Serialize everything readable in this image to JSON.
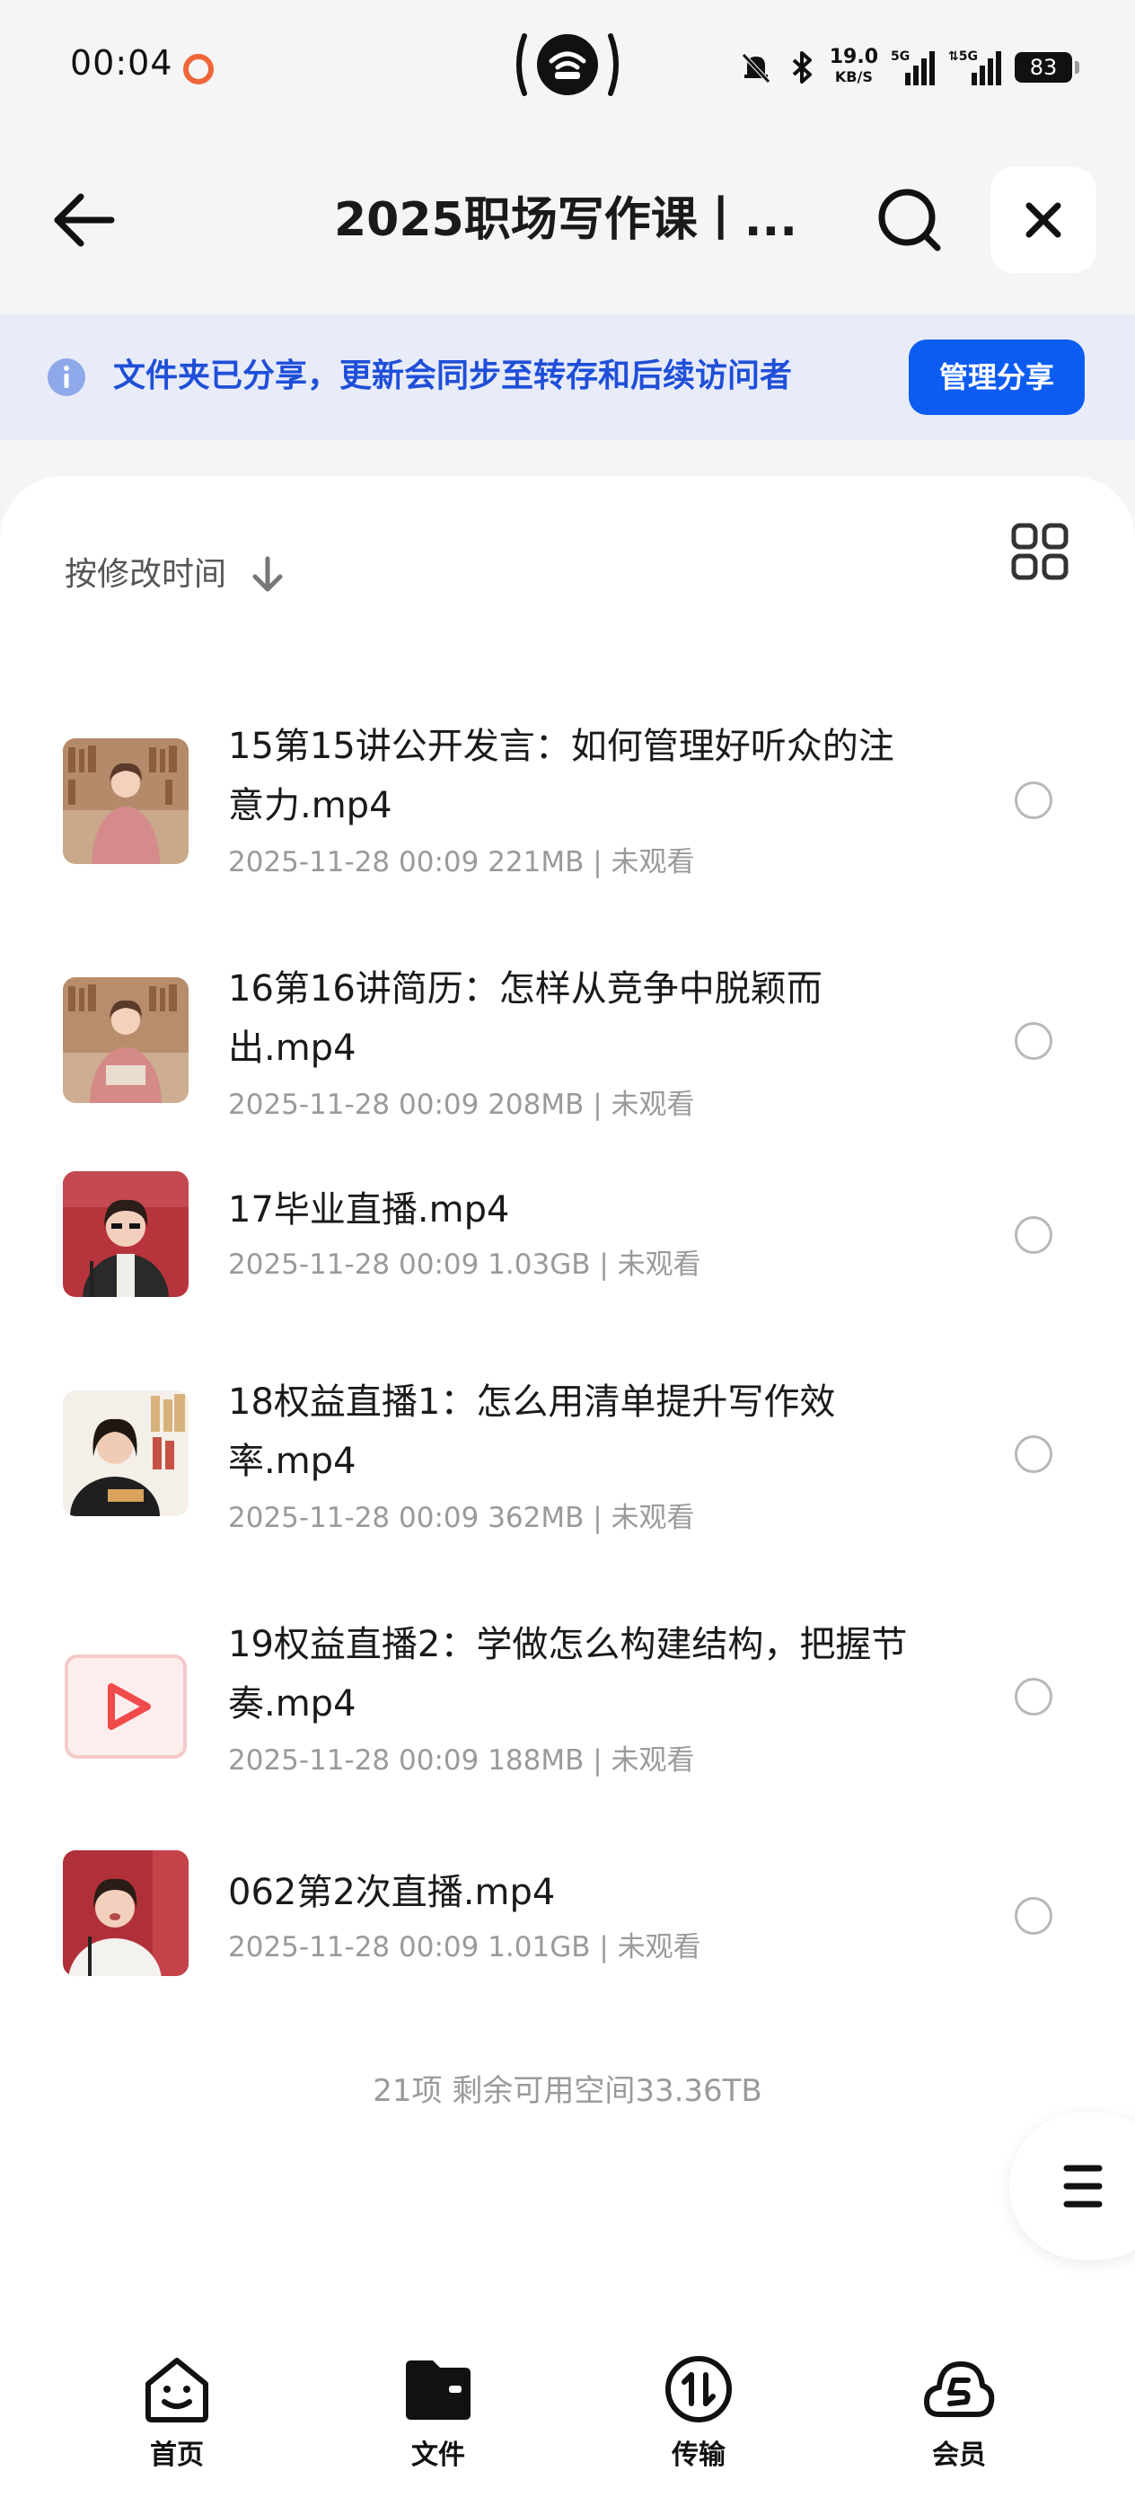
{
  "status_bar": {
    "time": "00:04",
    "net_speed_value": "19.0",
    "net_speed_unit": "KB/S",
    "battery": "83"
  },
  "header": {
    "title": "2025职场写作课丨..."
  },
  "banner": {
    "text": "文件夹已分享，更新会同步至转存和后续访问者",
    "manage_label": "管理分享"
  },
  "sort": {
    "label": "按修改时间"
  },
  "files": [
    {
      "name": "15第15讲公开发言：如何管理好听众的注意力.mp4",
      "meta": "2025-11-28 00:09  221MB | 未观看"
    },
    {
      "name": "16第16讲简历：怎样从竞争中脱颖而出.mp4",
      "meta": "2025-11-28 00:09  208MB | 未观看"
    },
    {
      "name": "17毕业直播.mp4",
      "meta": "2025-11-28 00:09  1.03GB | 未观看"
    },
    {
      "name": "18权益直播1：怎么用清单提升写作效率.mp4",
      "meta": "2025-11-28 00:09  362MB | 未观看"
    },
    {
      "name": "19权益直播2：学做怎么构建结构，把握节奏.mp4",
      "meta": "2025-11-28 00:09  188MB | 未观看"
    },
    {
      "name": "062第2次直播.mp4",
      "meta": "2025-11-28 00:09  1.01GB | 未观看"
    }
  ],
  "footer": {
    "summary": "21项 剩余可用空间33.36TB"
  },
  "nav": {
    "home": "首页",
    "files": "文件",
    "transfer": "传输",
    "member": "会员"
  },
  "colors": {
    "accent": "#0c5cf2",
    "banner_bg": "#e8ecf9",
    "banner_text": "#1f4fd8"
  }
}
